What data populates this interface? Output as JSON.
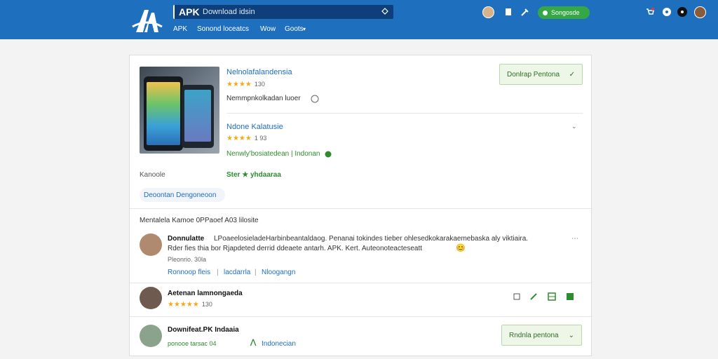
{
  "header": {
    "brand": "APK",
    "search_placeholder": "Download idsin",
    "nav": [
      "APK",
      "Sonond loceatcs",
      "Wow",
      "Goots"
    ],
    "action_button": "Songosde"
  },
  "app": {
    "title": "Nelnolafalandensia",
    "rating_count": "130",
    "description": "Nemmpnkolkadan luoer",
    "install_button": "Donlrap Pentona",
    "caption": "Kanoole",
    "chip": "Deoontan Dengoneoon"
  },
  "related": {
    "title": "Ndone Kalatusie",
    "rating_count": "1 93",
    "publisher": "Nenwly'bosiatedean | Indonan",
    "tag": "Ster ★ yhdaaraa"
  },
  "comments": {
    "header": "Mentalela  Kamoe 0PPaoef A03 lilosite",
    "items": [
      {
        "name": "Donnulatte",
        "text1": "LPoaeelosieladeHarbinbeantaldaog. Penanai tokindes tieber ohlesedkokarakaemebaska aly viktiaira.",
        "text2": "Rder fies thia  bor Rjapdeted derrid ddeaete antarh. APK. Kert. Auteonoteacteseatt",
        "meta": "Pleonrio. 30la",
        "links": [
          "Ronnoop  fleis",
          "lacdarrla",
          "Nloogangn"
        ]
      },
      {
        "name": "Aetenan lamnongaeda",
        "rating_count": "130",
        "actions": [
          "copy-icon",
          "pin-icon",
          "grid-icon",
          "square-icon"
        ]
      },
      {
        "name": "Downifeat.PK Indaaia",
        "meta": "ponooe tarsac   04",
        "location": "Indonecian",
        "button": "Rndnla pentona"
      }
    ]
  },
  "colors": {
    "header": "#1f6fbf",
    "accent": "#35a845",
    "link": "#1f6fbf"
  }
}
